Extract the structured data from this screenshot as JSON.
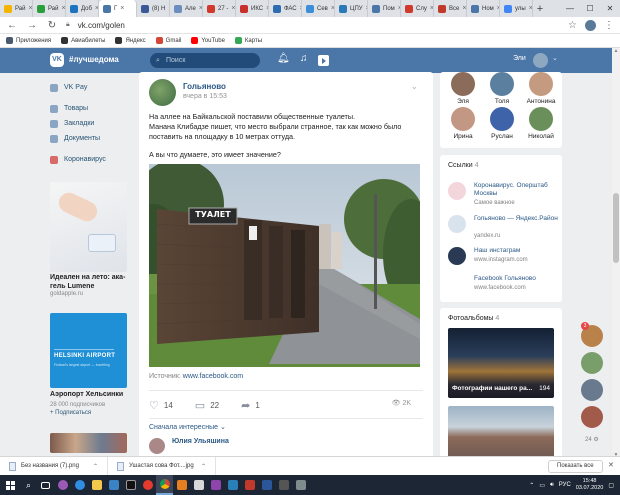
{
  "browser": {
    "tabs": [
      {
        "label": "Рай",
        "color": "#f4b400"
      },
      {
        "label": "Рай",
        "color": "#2a9d3c"
      },
      {
        "label": "Доб",
        "color": "#1e73be"
      },
      {
        "label": "Г",
        "color": "#4a76a8",
        "active": true
      },
      {
        "label": "(8) Н",
        "color": "#3b5998"
      },
      {
        "label": "Але",
        "color": "#6c8ebf"
      },
      {
        "label": "27 -",
        "color": "#d0392b"
      },
      {
        "label": "ИКС",
        "color": "#c9302c"
      },
      {
        "label": "ФАС",
        "color": "#2d6cb3"
      },
      {
        "label": "Сев",
        "color": "#3a8fd8"
      },
      {
        "label": "ЦПУ",
        "color": "#2a7ab8"
      },
      {
        "label": "Пом",
        "color": "#4a76a8"
      },
      {
        "label": "Слу",
        "color": "#d0392b"
      },
      {
        "label": "Все",
        "color": "#c0392b"
      },
      {
        "label": "Ном",
        "color": "#4a76a8"
      },
      {
        "label": "улы",
        "color": "#4285f4"
      }
    ],
    "url": "vk.com/golen",
    "bookmarks": [
      {
        "label": "Приложения",
        "color": "#4a5a6e"
      },
      {
        "label": "Авиабилеты",
        "color": "#333333"
      },
      {
        "label": "Яндекс",
        "color": "#333333"
      },
      {
        "label": "Gmail",
        "color": "#d44638"
      },
      {
        "label": "YouTube",
        "color": "#ff0000"
      },
      {
        "label": "Карты",
        "color": "#34a853"
      }
    ]
  },
  "vk_header": {
    "logo": "VK",
    "hashtag": "#лучшедома",
    "search_placeholder": "Поиск",
    "user_name": "Эли"
  },
  "left_nav": {
    "items": [
      {
        "label": "VK Pay",
        "icon": "vkpay-icon"
      },
      {
        "label": "Товары",
        "icon": "market-icon"
      },
      {
        "label": "Закладки",
        "icon": "bookmark-icon"
      },
      {
        "label": "Документы",
        "icon": "docs-icon"
      },
      {
        "label": "Коронавирус",
        "icon": "virus-icon"
      }
    ],
    "ads": [
      {
        "title": "Идеален на лето: ака-гель Lumene",
        "subtitle": "goldapple.ru"
      },
      {
        "title": "Аэропорт Хельсинки",
        "subtitle": "28 000 подписчиков",
        "join": "+ Подписаться",
        "image_text": "HELSINKI AIRPORT",
        "image_sub": "Finland's largest airport — travelling"
      }
    ]
  },
  "post": {
    "author": "Гольяново",
    "date": "вчера в 15:53",
    "text_lines": [
      "На аллее на Байкальской поставили общественные туалеты.",
      "Манана Клибадзе пишет, что место выбрали странное, так как можно было",
      "поставить на площадку в 10 метрах оттуда."
    ],
    "question": "А вы что думаете, это имеет значение?",
    "photo_sign": "ТУАЛЕТ",
    "source_label": "Источник:",
    "source_link": "www.facebook.com",
    "likes": "14",
    "comments": "22",
    "shares": "1",
    "views": "2K",
    "sort_label": "Сначала интересные",
    "first_commenter": "Юлия Ульяшина"
  },
  "friends": [
    {
      "name": "Эля",
      "color": "#8b6b5a"
    },
    {
      "name": "Толя",
      "color": "#5b7f9e"
    },
    {
      "name": "Антонина",
      "color": "#c49a80"
    },
    {
      "name": "Ирина",
      "color": "#c29884"
    },
    {
      "name": "Руслан",
      "color": "#3f63a8"
    },
    {
      "name": "Николай",
      "color": "#6a8f5a"
    }
  ],
  "links": {
    "title": "Ссылки",
    "count": "4",
    "items": [
      {
        "title": "Коронавирус. Оперштаб Москвы",
        "sub": "Самое важное",
        "color": "#f3d6dc"
      },
      {
        "title": "Гольяново — Яндекс.Район",
        "sub": "yandex.ru",
        "color": "#d9e3ee"
      },
      {
        "title": "Наш инстаграм",
        "sub": "www.instagram.com",
        "color": "#2a3a55"
      },
      {
        "title": "Facebook Гольяново",
        "sub": "www.facebook.com",
        "color": "#ffffff"
      }
    ]
  },
  "albums": {
    "title": "Фотоальбомы",
    "count": "4",
    "first_caption": "Фотографии нашего ра...",
    "first_count": "194"
  },
  "chats": {
    "badge": "3",
    "count": "24"
  },
  "downloads": {
    "items": [
      {
        "name": "Без названия (7).png"
      },
      {
        "name": "Ушастая сова Фот....jpg"
      }
    ],
    "show_all": "Показать все"
  },
  "taskbar": {
    "lang": "РУС",
    "time": "15:48",
    "date": "03.07.2020"
  }
}
